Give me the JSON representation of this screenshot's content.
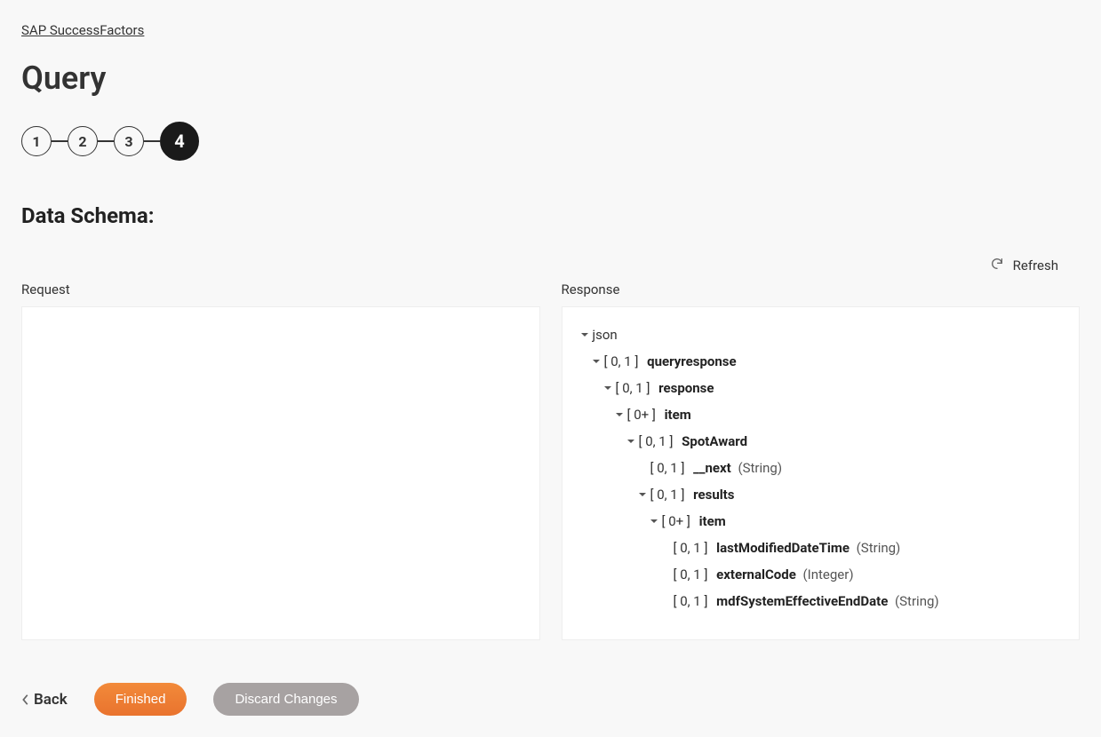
{
  "breadcrumb": "SAP SuccessFactors",
  "page_title": "Query",
  "stepper": {
    "steps": [
      {
        "label": "1",
        "active": false
      },
      {
        "label": "2",
        "active": false
      },
      {
        "label": "3",
        "active": false
      },
      {
        "label": "4",
        "active": true
      }
    ]
  },
  "section_title": "Data Schema:",
  "refresh_label": "Refresh",
  "panels": {
    "request_label": "Request",
    "response_label": "Response",
    "response_tree": [
      {
        "indent": 0,
        "expandable": true,
        "cardinality": "",
        "name": "json",
        "type": "",
        "root": true
      },
      {
        "indent": 1,
        "expandable": true,
        "cardinality": "[ 0, 1 ]",
        "name": "queryresponse",
        "type": ""
      },
      {
        "indent": 2,
        "expandable": true,
        "cardinality": "[ 0, 1 ]",
        "name": "response",
        "type": ""
      },
      {
        "indent": 3,
        "expandable": true,
        "cardinality": "[ 0+ ]",
        "name": "item",
        "type": ""
      },
      {
        "indent": 4,
        "expandable": true,
        "cardinality": "[ 0, 1 ]",
        "name": "SpotAward",
        "type": ""
      },
      {
        "indent": 5,
        "expandable": false,
        "cardinality": "[ 0, 1 ]",
        "name": "__next",
        "type": "(String)"
      },
      {
        "indent": 5,
        "expandable": true,
        "cardinality": "[ 0, 1 ]",
        "name": "results",
        "type": ""
      },
      {
        "indent": 6,
        "expandable": true,
        "cardinality": "[ 0+ ]",
        "name": "item",
        "type": ""
      },
      {
        "indent": 7,
        "expandable": false,
        "cardinality": "[ 0, 1 ]",
        "name": "lastModifiedDateTime",
        "type": "(String)"
      },
      {
        "indent": 7,
        "expandable": false,
        "cardinality": "[ 0, 1 ]",
        "name": "externalCode",
        "type": "(Integer)"
      },
      {
        "indent": 7,
        "expandable": false,
        "cardinality": "[ 0, 1 ]",
        "name": "mdfSystemEffectiveEndDate",
        "type": "(String)"
      }
    ]
  },
  "footer": {
    "back": "Back",
    "finished": "Finished",
    "discard": "Discard Changes"
  }
}
